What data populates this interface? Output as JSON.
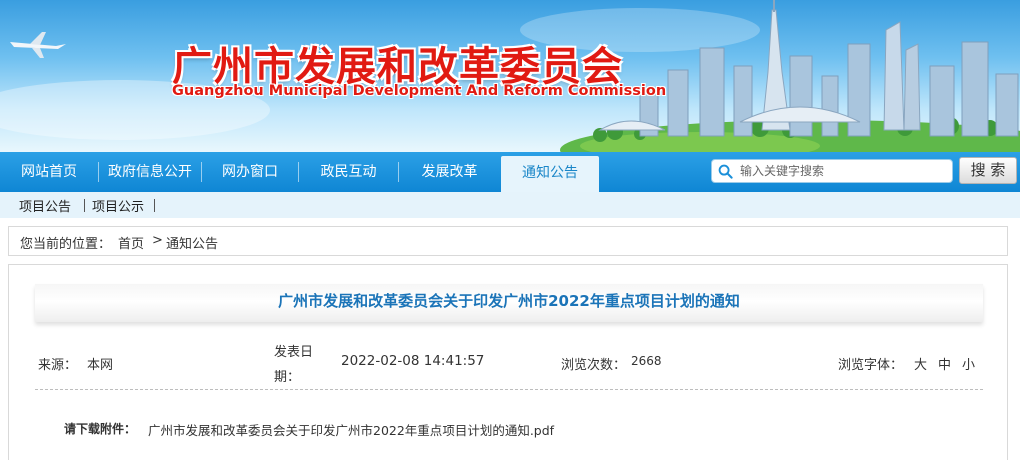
{
  "header": {
    "title": "广州市发展和改革委员会",
    "subtitle": "Guangzhou Municipal Development And Reform Commission"
  },
  "nav": {
    "items": [
      {
        "label": "网站首页"
      },
      {
        "label": "政府信息公开"
      },
      {
        "label": "网办窗口"
      },
      {
        "label": "政民互动"
      },
      {
        "label": "发展改革"
      },
      {
        "label": "通知公告",
        "active": true
      }
    ],
    "search": {
      "placeholder": "输入关键字搜索",
      "button_label": "搜 索"
    }
  },
  "subnav": {
    "items": [
      {
        "label": "项目公告"
      },
      {
        "label": "项目公示"
      }
    ]
  },
  "breadcrumb": {
    "prefix": "您当前的位置：",
    "home": "首页",
    "separator": ">",
    "current": "通知公告"
  },
  "article": {
    "title": "广州市发展和改革委员会关于印发广州市2022年重点项目计划的通知",
    "source_label": "来源：",
    "source_value": "本网",
    "date_label_line1": "发表日",
    "date_label_line2": "期：",
    "date_value": "2022-02-08 14:41:57",
    "views_label": "浏览次数：",
    "views_value": "2668",
    "font_label": "浏览字体：",
    "font_options": [
      "大",
      "中",
      "小"
    ],
    "attachment_label": "请下载附件：",
    "attachment_name": "广州市发展和改革委员会关于印发广州市2022年重点项目计划的通知.pdf"
  },
  "colors": {
    "title_red": "#e11a12",
    "nav_blue": "#1a8fd9",
    "active_tab_bg": "#e6f4fc",
    "article_title_blue": "#1b74b8"
  }
}
